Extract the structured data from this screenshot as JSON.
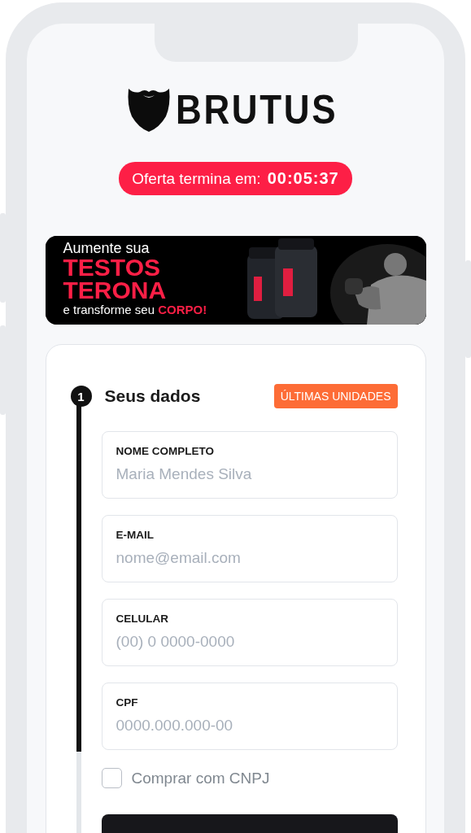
{
  "logo": {
    "text": "BRUTUS"
  },
  "timer": {
    "label": "Oferta termina em:",
    "time": "00:05:37"
  },
  "banner": {
    "lines": [
      "Aumente sua",
      "TESTOS",
      "TERONA",
      "e transforme seu **CORPO!**"
    ],
    "kind": "picture"
  },
  "step": {
    "number": "1",
    "title": "Seus dados",
    "badge": "ÚLTIMAS UNIDADES"
  },
  "fields": [
    {
      "label": "NOME COMPLETO",
      "placeholder": "Maria Mendes Silva"
    },
    {
      "label": "E-MAIL",
      "placeholder": "nome@email.com"
    },
    {
      "label": "CELULAR",
      "placeholder": "(00) 0 0000-0000"
    },
    {
      "label": "CPF",
      "placeholder": "0000.000.000-00"
    }
  ],
  "cnpj": {
    "label": "Comprar com CNPJ",
    "checked": false
  }
}
